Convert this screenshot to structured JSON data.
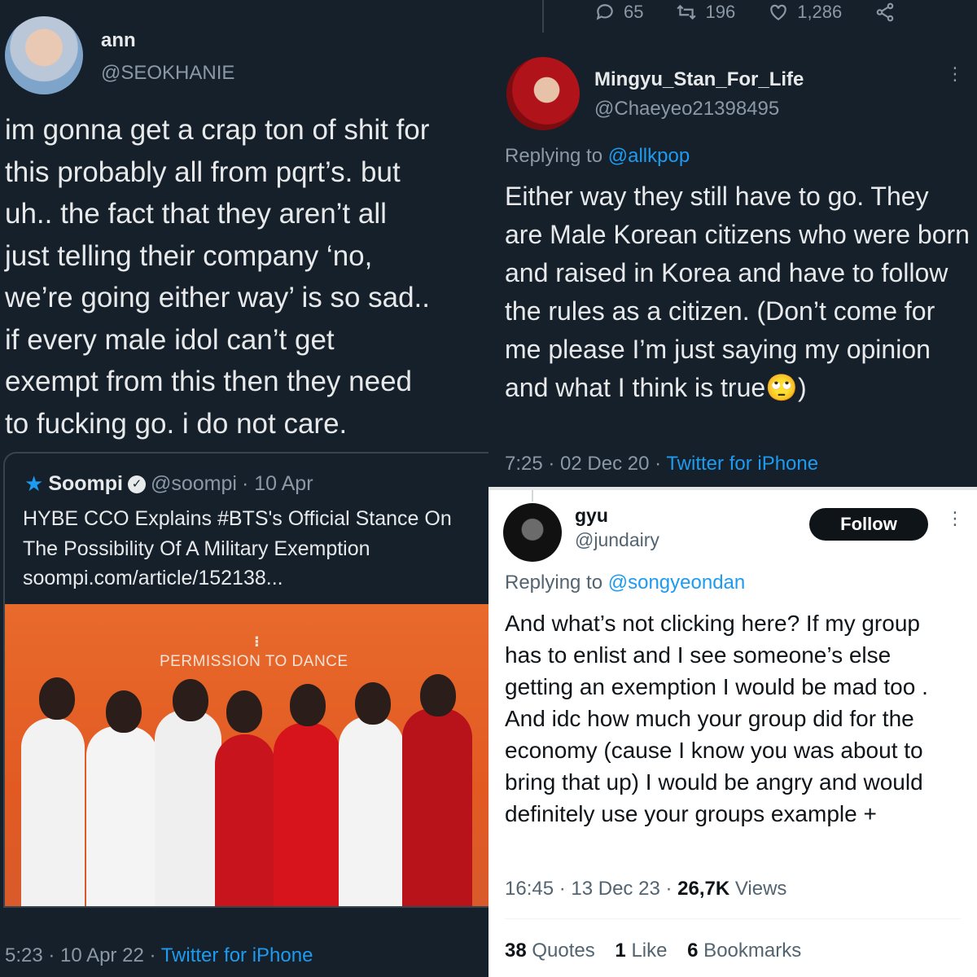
{
  "left_tweet": {
    "name": "ann",
    "handle": "@SEOKHANIE",
    "text": "im gonna get a crap ton of shit for\nthis probably all from pqrt’s. but\nuh.. the fact that they aren’t all\njust telling their company ‘no,\nwe’re going either way’ is so sad..\nif every male idol can’t get\nexempt from this then they need\nto fucking go. i do not care.",
    "quote": {
      "name": "Soompi",
      "handle": "@soompi",
      "date": "· 10 Apr",
      "text": "HYBE CCO Explains #BTS's Official Stance On The Possibility Of A Military Exemption",
      "link": "soompi.com/article/152138...",
      "photo_banner": "PERMISSION TO DANCE"
    },
    "time": "5:23 · 10 Apr 22 · ",
    "source": "Twitter for iPhone"
  },
  "right_top_tweet": {
    "actions": {
      "replies": "65",
      "retweets": "196",
      "likes": "1,286"
    },
    "name": "Mingyu_Stan_For_Life",
    "handle": "@Chaeyeo21398495",
    "replying_label": "Replying to ",
    "replying_to": "@allkpop",
    "text": "Either way they still have to go. They are Male Korean citizens who were born and raised in Korea and have to follow the rules as a citizen. (Don’t come for me please I’m just saying my opinion and what I think is true🙄)",
    "time": "7:25 · 02 Dec 20 · ",
    "source": "Twitter for iPhone"
  },
  "right_bottom_tweet": {
    "name": "gyu",
    "handle": "@jundairy",
    "follow_label": "Follow",
    "replying_label": "Replying to ",
    "replying_to": "@songyeondan",
    "text": "And what’s not clicking here? If my group has to enlist and I see someone’s else getting an exemption I would be mad too . And idc how much your group did for the economy (cause I know you was about to bring that up) I would be angry and would definitely use your groups example +",
    "time": "16:45 · 13 Dec 23 · ",
    "views_count": "26,7K",
    "views_label": " Views",
    "stats": {
      "quotes_count": "38",
      "quotes_label": " Quotes",
      "likes_count": "1",
      "likes_label": " Like",
      "bookmarks_count": "6",
      "bookmarks_label": " Bookmarks"
    }
  }
}
